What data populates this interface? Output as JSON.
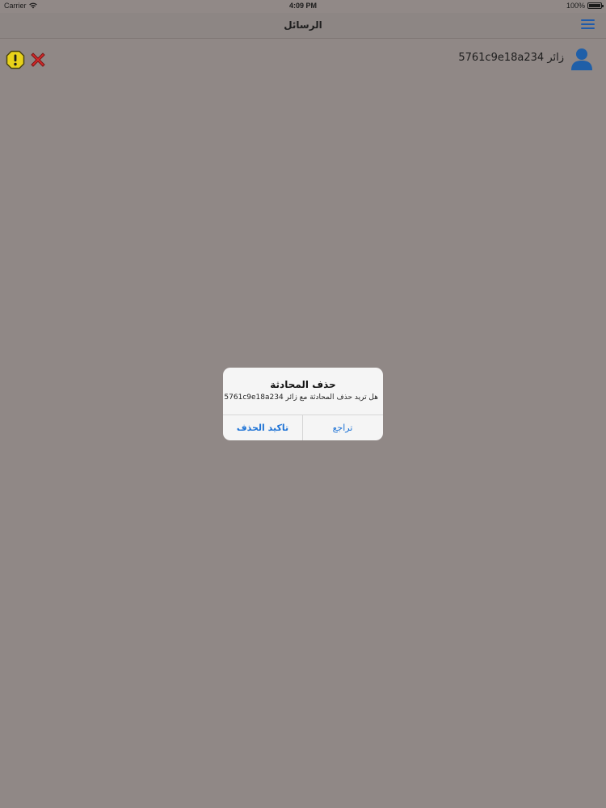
{
  "status_bar": {
    "carrier": "Carrier",
    "time": "4:09 PM",
    "battery": "100%"
  },
  "nav": {
    "title": "الرسائل",
    "menu_icon": "hamburger-menu-icon"
  },
  "conversation": {
    "visitor_name": "5761c9e18a234 زائر",
    "avatar_icon": "user-avatar-icon",
    "warning_icon": "warning-icon",
    "delete_icon": "delete-x-icon"
  },
  "alert": {
    "title": "حذف المحادثة",
    "message": "هل تريد حذف المحادثة مع زائر 5761c9e18a234",
    "confirm_label": "تاكيد الحذف",
    "cancel_label": "تراجع"
  },
  "colors": {
    "overlay_background": "#908886",
    "accent_blue": "#1e73d6",
    "menu_icon_blue": "#1e5bab",
    "delete_red": "#d42a2a",
    "warning_yellow": "#e8d21a"
  }
}
